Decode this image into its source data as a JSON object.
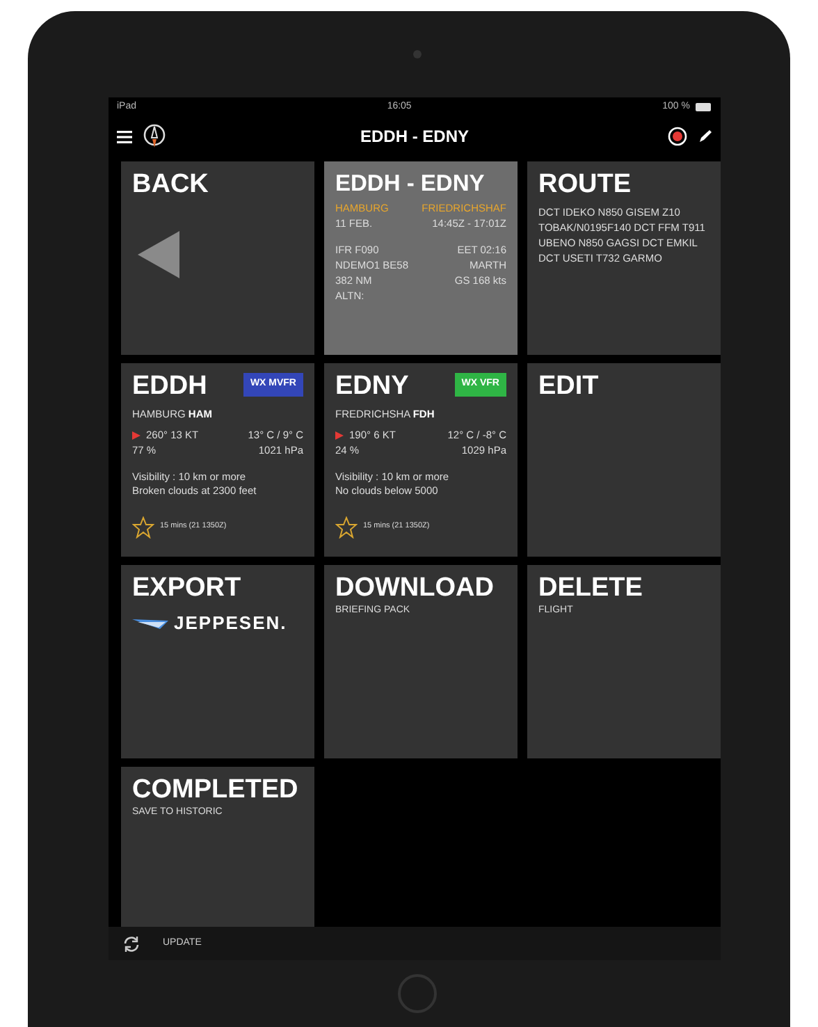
{
  "status_bar": {
    "device": "iPad",
    "time": "16:05",
    "battery": "100 %"
  },
  "nav": {
    "title": "EDDH - EDNY"
  },
  "tiles": [
    {
      "kind": "back",
      "title": "BACK",
      "selected": false
    },
    {
      "kind": "flight",
      "title": "EDDH - EDNY",
      "selected": true,
      "from": "HAMBURG",
      "to": "FRIEDRICHSHAF",
      "date": "11 FEB.",
      "times": "14:45Z - 17:01Z",
      "lines": [
        {
          "left": "IFR F090",
          "right": "EET 02:16"
        },
        {
          "left": "NDEMO1 BE58",
          "right": "MARTH"
        },
        {
          "left": "382 NM",
          "right": "GS 168 kts"
        },
        {
          "left": "ALTN:"
        }
      ]
    },
    {
      "kind": "route",
      "title": "ROUTE",
      "selected": false,
      "text": "DCT IDEKO N850 GISEM Z10 TOBAK/N0195F140 DCT FFM T911 UBENO N850 GAGSI DCT EMKIL DCT USETI T732 GARMO"
    },
    {
      "kind": "airport",
      "title": "EDDH",
      "selected": false,
      "badge": "WX MVFR",
      "color": "#3346b8",
      "city": "HAMBURG",
      "code": "HAM",
      "wind": "260° 13 KT",
      "temp": "13° C / 9° C",
      "humidity": "77 %",
      "pressure": "1021 hPa",
      "visibility": "Visibility : 10 km or more",
      "clouds": "Broken clouds at 2300 feet",
      "favorite": false,
      "age": "15 mins (21 1350Z)"
    },
    {
      "kind": "airport",
      "title": "EDNY",
      "selected": false,
      "badge": "WX VFR",
      "color": "#2fb545",
      "city": "FREDRICHSHA",
      "code": "FDH",
      "wind": "190° 6 KT",
      "temp": "12° C / -8° C",
      "humidity": "24 %",
      "pressure": "1029 hPa",
      "visibility": "Visibility : 10 km or more",
      "clouds": "No clouds below 5000",
      "favorite": false,
      "age": "15 mins (21 1350Z)"
    },
    {
      "kind": "action",
      "title": "EDIT",
      "selected": false
    },
    {
      "kind": "export",
      "title": "EXPORT",
      "selected": false,
      "logo": "JEPPESEN."
    },
    {
      "kind": "action",
      "title": "DOWNLOAD",
      "selected": false,
      "subtitle": "BRIEFING PACK"
    },
    {
      "kind": "action",
      "title": "DELETE",
      "selected": false,
      "subtitle": "FLIGHT"
    },
    {
      "kind": "action",
      "title": "COMPLETED",
      "selected": false,
      "subtitle": "SAVE TO HISTORIC"
    }
  ],
  "bottom_bar": {
    "label": "UPDATE"
  }
}
